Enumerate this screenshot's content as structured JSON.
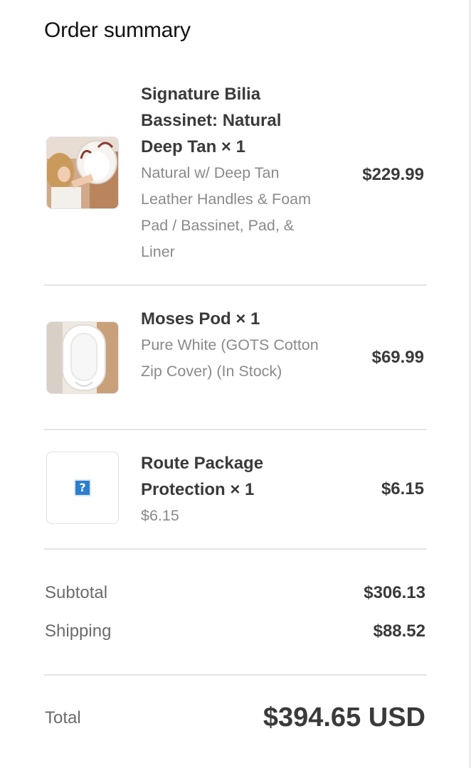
{
  "heading": "Order summary",
  "items": [
    {
      "title": "Signature Bilia Bassinet: Natural Deep Tan × 1",
      "variant": "Natural w/ Deep Tan Leather Handles & Foam Pad / Bassinet, Pad, & Liner",
      "price": "$229.99",
      "thumbnail": "bassinet-product-photo"
    },
    {
      "title": "Moses Pod × 1",
      "variant": "Pure White (GOTS Cotton Zip Cover) (In Stock)",
      "price": "$69.99",
      "thumbnail": "moses-pod-product-photo"
    },
    {
      "title": "Route Package Protection × 1",
      "variant": "$6.15",
      "price": "$6.15",
      "thumbnail": "broken-image-icon"
    }
  ],
  "summary": {
    "subtotal_label": "Subtotal",
    "subtotal_value": "$306.13",
    "shipping_label": "Shipping",
    "shipping_value": "$88.52",
    "total_label": "Total",
    "total_value": "$394.65 USD"
  },
  "colors": {
    "text_primary": "#3a3a3a",
    "text_secondary": "#8a8a8a",
    "divider": "#e4e4e4",
    "placeholder_icon": "#2b7fce"
  }
}
